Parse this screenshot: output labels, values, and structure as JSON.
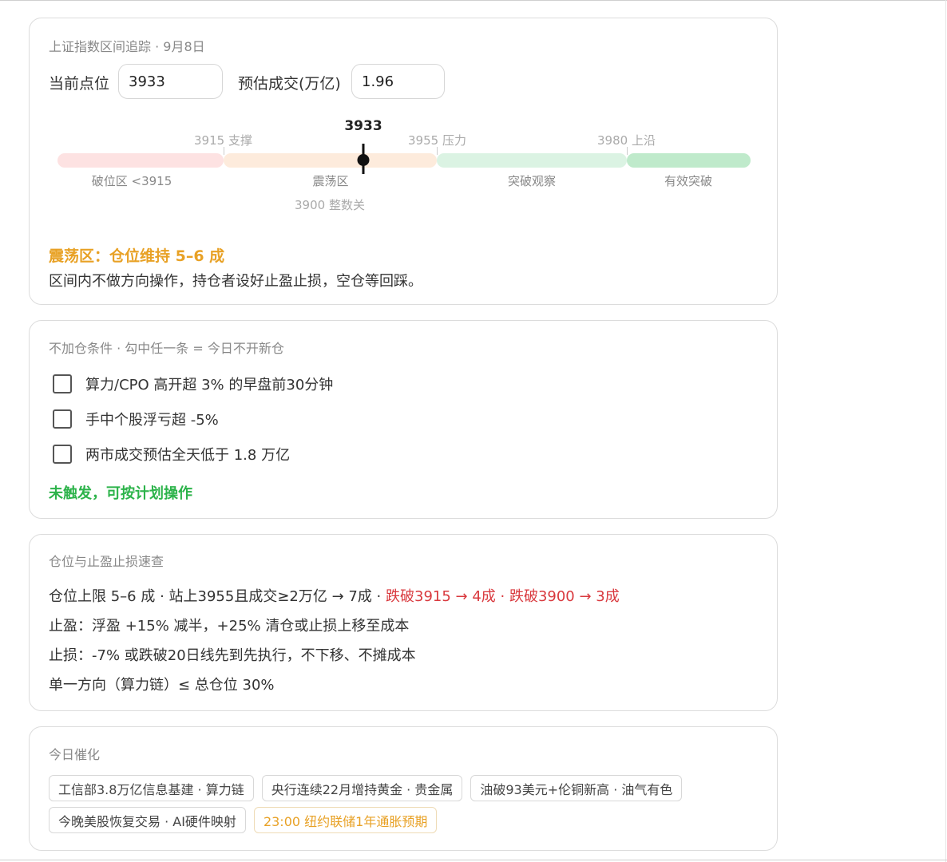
{
  "tracker": {
    "title": "上证指数区间追踪 · 9月8日",
    "current_label": "当前点位",
    "current_value": "3933",
    "volume_label": "预估成交(万亿)",
    "volume_value": "1.96",
    "marker_value": "3933",
    "ticks": [
      {
        "label": "3915 支撑"
      },
      {
        "label": "3955 压力"
      },
      {
        "label": "3980 上沿"
      }
    ],
    "sub_tick": "3900 整数关",
    "zones": [
      {
        "label": "破位区 <3915",
        "color": "#fde2e2"
      },
      {
        "label": "震荡区",
        "color": "#fdebdc"
      },
      {
        "label": "突破观察",
        "color": "#dbf3e3"
      },
      {
        "label": "有效突破",
        "color": "#bfeacb"
      }
    ],
    "status_title": "震荡区：仓位维持 5–6 成",
    "status_desc": "区间内不做方向操作，持仓者设好止盈止损，空仓等回踩。",
    "status_color": "#e8a125"
  },
  "conditions": {
    "title": "不加仓条件 · 勾中任一条 = 今日不开新仓",
    "items": [
      {
        "label": "算力/CPO 高开超 3% 的早盘前30分钟",
        "checked": false
      },
      {
        "label": "手中个股浮亏超 -5%",
        "checked": false
      },
      {
        "label": "两市成交预估全天低于 1.8 万亿",
        "checked": false
      }
    ],
    "status": "未触发，可按计划操作",
    "status_color": "#2cb34a"
  },
  "positions": {
    "title": "仓位与止盈止损速查",
    "line1_normal": "仓位上限 5–6 成 · 站上3955且成交≥2万亿 → 7成 · ",
    "line1_red": "跌破3915 → 4成 · 跌破3900 → 3成",
    "line2": "止盈：浮盈 +15% 减半，+25% 清仓或止损上移至成本",
    "line3": "止损：-7% 或跌破20日线先到先执行，不下移、不摊成本",
    "line4": "单一方向（算力链）≤ 总仓位 30%"
  },
  "catalysts": {
    "title": "今日催化",
    "tags": [
      "工信部3.8万亿信息基建 · 算力链",
      "央行连续22月增持黄金 · 贵金属",
      "油破93美元+伦铜新高 · 油气有色",
      "今晚美股恢复交易 · AI硬件映射",
      "23:00 纽约联储1年通胀预期"
    ],
    "warn_color": "#e8a125"
  }
}
